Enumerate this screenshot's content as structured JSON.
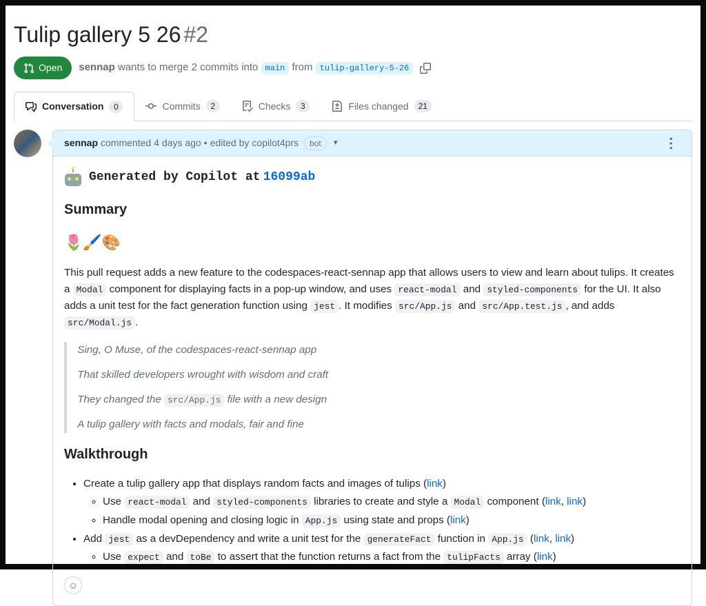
{
  "pr": {
    "title": "Tulip gallery 5 26",
    "number": "#2",
    "state": "Open",
    "author": "sennap",
    "merge_text_1": "wants to merge 2 commits into",
    "base_branch": "main",
    "merge_text_2": "from",
    "head_branch": "tulip-gallery-5-26"
  },
  "tabs": {
    "conversation": {
      "label": "Conversation",
      "count": "0"
    },
    "commits": {
      "label": "Commits",
      "count": "2"
    },
    "checks": {
      "label": "Checks",
      "count": "3"
    },
    "files": {
      "label": "Files changed",
      "count": "21"
    }
  },
  "comment": {
    "header_author": "sennap",
    "header_action": "commented",
    "header_time": "4 days ago",
    "header_sep": "•",
    "header_edited": "edited by copilot4prs",
    "bot_label": "bot",
    "gen_text": "Generated by Copilot at",
    "commit": "16099ab",
    "summary_heading": "Summary",
    "emoji_row": "🌷🖌️🎨",
    "p1_a": "This pull request adds a new feature to the codespaces-react-sennap app that allows users to view and learn about tulips. It creates a ",
    "code_modal": "Modal",
    "p1_b": " component for displaying facts in a pop-up window, and uses ",
    "code_rm": "react-modal",
    "p1_and": " and ",
    "code_sc": "styled-components",
    "p1_c": " for the UI. It also adds a unit test for the fact generation function using ",
    "code_jest": "jest",
    "p1_d": ". It modifies ",
    "code_appjs": "src/App.js",
    "code_apptest": "src/App.test.js",
    "p1_e": ", and adds ",
    "code_modaljs": "src/Modal.js",
    "p1_f": ".",
    "bq1": "Sing, O Muse, of the codespaces-react-sennap app",
    "bq2": "That skilled developers wrought with wisdom and craft",
    "bq3_a": "They changed the ",
    "bq3_b": " file with a new design",
    "bq4": "A tulip gallery with facts and modals, fair and fine",
    "walkthrough_heading": "Walkthrough",
    "li1": "Create a tulip gallery app that displays random facts and images of tulips (",
    "li1a_a": "Use ",
    "li1a_b": " libraries to create and style a ",
    "li1a_c": " component (",
    "li1b_a": "Handle modal opening and closing logic in ",
    "code_appjs_short": "App.js",
    "li1b_b": " using state and props (",
    "li2_a": "Add ",
    "li2_b": " as a devDependency and write a unit test for the ",
    "code_genfact": "generateFact",
    "li2_c": " function in ",
    "li2_d": " (",
    "li2a_a": "Use ",
    "code_expect": "expect",
    "code_tobe": "toBe",
    "li2a_b": " to assert that the function returns a fact from the ",
    "code_tulipfacts": "tulipFacts",
    "li2a_c": " array (",
    "link_text": "link",
    "comma": ", ",
    "close_paren": ")"
  }
}
